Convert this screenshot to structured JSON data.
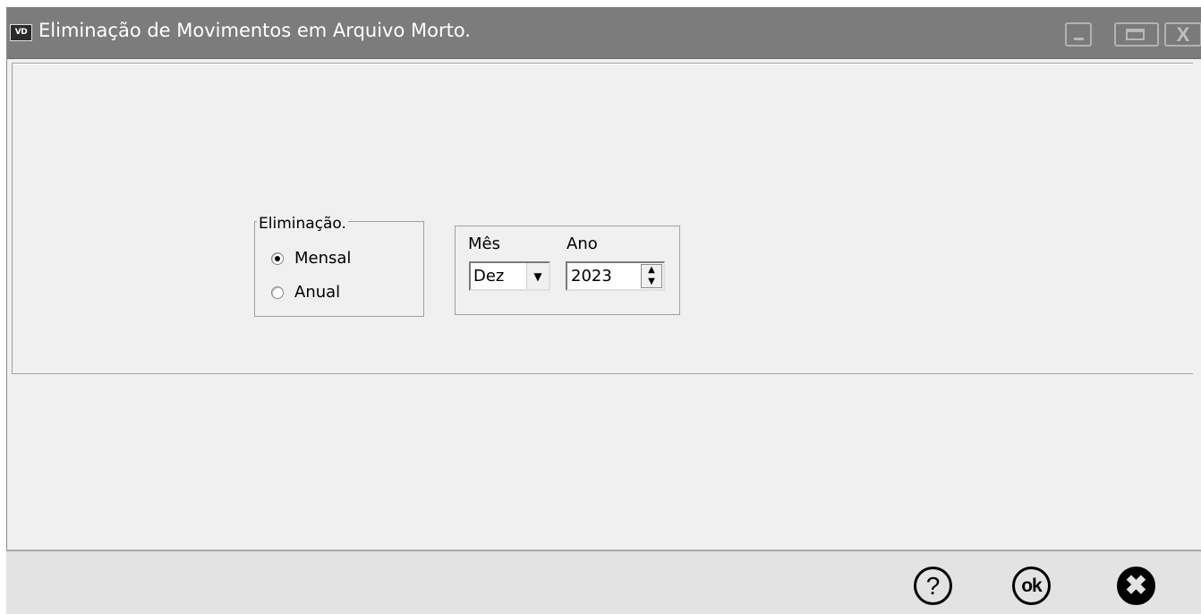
{
  "window": {
    "app_icon_text": "VD",
    "title": "Eliminação de Movimentos em Arquivo Morto.",
    "controls": [
      "minimize-icon",
      "maximize-icon",
      "close-icon"
    ]
  },
  "elimination_group": {
    "legend": "Eliminação.",
    "options": [
      {
        "label": "Mensal",
        "selected": true
      },
      {
        "label": "Anual",
        "selected": false
      }
    ]
  },
  "period": {
    "month_label": "Mês",
    "month_value": "Dez",
    "year_label": "Ano",
    "year_value": "2023"
  },
  "footer": {
    "help_icon": "?",
    "ok_icon": "ok",
    "cancel_icon": "✖"
  }
}
